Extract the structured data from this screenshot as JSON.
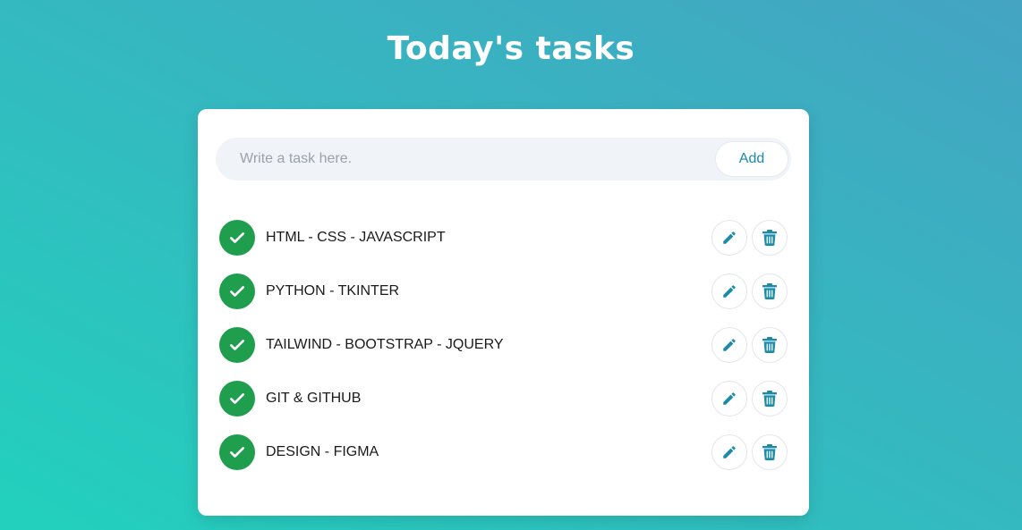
{
  "page": {
    "title": "Today's tasks"
  },
  "form": {
    "placeholder": "Write a task here.",
    "add_label": "Add"
  },
  "tasks": [
    {
      "label": "HTML - CSS - JAVASCRIPT",
      "completed": true
    },
    {
      "label": "PYTHON - TKINTER",
      "completed": true
    },
    {
      "label": "TAILWIND - BOOTSTRAP - JQUERY",
      "completed": true
    },
    {
      "label": "GIT & GITHUB",
      "completed": true
    },
    {
      "label": "DESIGN - FIGMA",
      "completed": true
    }
  ],
  "icons": {
    "check": "check-icon",
    "edit": "pencil-icon",
    "delete": "trash-icon"
  },
  "colors": {
    "accent": "#1c8ba8",
    "complete": "#1f9e4e",
    "card": "#ffffff",
    "input_bg": "#f0f3f8"
  }
}
